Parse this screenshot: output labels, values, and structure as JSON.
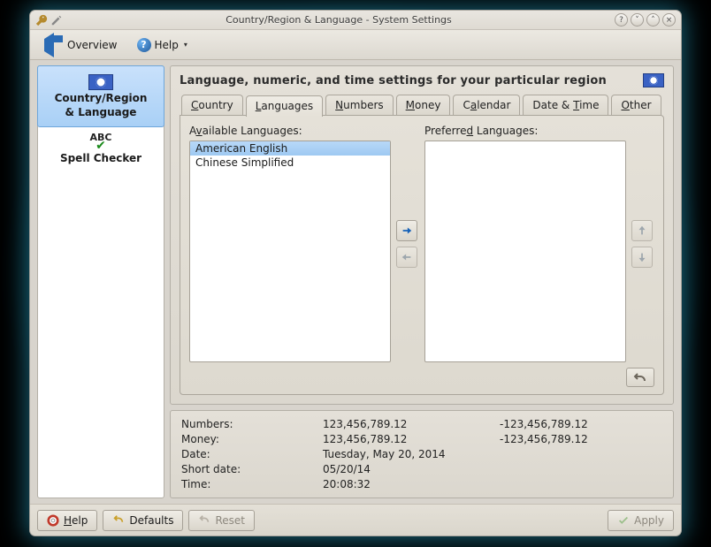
{
  "window": {
    "title": "Country/Region & Language - System Settings"
  },
  "toolbar": {
    "overview": "Overview",
    "help": "Help"
  },
  "sidebar": {
    "items": [
      {
        "label_line1": "Country/Region",
        "label_line2": "& Language"
      },
      {
        "label": "Spell Checker"
      }
    ]
  },
  "heading": "Language, numeric, and time settings for your particular region",
  "tabs": [
    {
      "pre": "",
      "u": "C",
      "post": "ountry"
    },
    {
      "pre": "",
      "u": "L",
      "post": "anguages"
    },
    {
      "pre": "",
      "u": "N",
      "post": "umbers"
    },
    {
      "pre": "",
      "u": "M",
      "post": "oney"
    },
    {
      "pre": "C",
      "u": "a",
      "post": "lendar"
    },
    {
      "pre": "Date & ",
      "u": "T",
      "post": "ime"
    },
    {
      "pre": "",
      "u": "O",
      "post": "ther"
    }
  ],
  "labels": {
    "available_pre": "A",
    "available_u": "v",
    "available_post": "ailable Languages:",
    "preferred_pre": "Preferre",
    "preferred_u": "d",
    "preferred_post": " Languages:"
  },
  "available": [
    "American English",
    "Chinese Simplified"
  ],
  "preferred": [],
  "examples": {
    "rows": [
      {
        "name": "Numbers:",
        "v1": "123,456,789.12",
        "v2": "-123,456,789.12"
      },
      {
        "name": "Money:",
        "v1": " 123,456,789.12",
        "v2": "-123,456,789.12"
      },
      {
        "name": "Date:",
        "v1": "Tuesday, May 20, 2014",
        "v2": ""
      },
      {
        "name": "Short date:",
        "v1": "05/20/14",
        "v2": ""
      },
      {
        "name": "Time:",
        "v1": "20:08:32",
        "v2": ""
      }
    ]
  },
  "footer": {
    "help_u": "H",
    "help_post": "elp",
    "defaults": "Defaults",
    "reset": "Reset",
    "apply": "Apply"
  }
}
